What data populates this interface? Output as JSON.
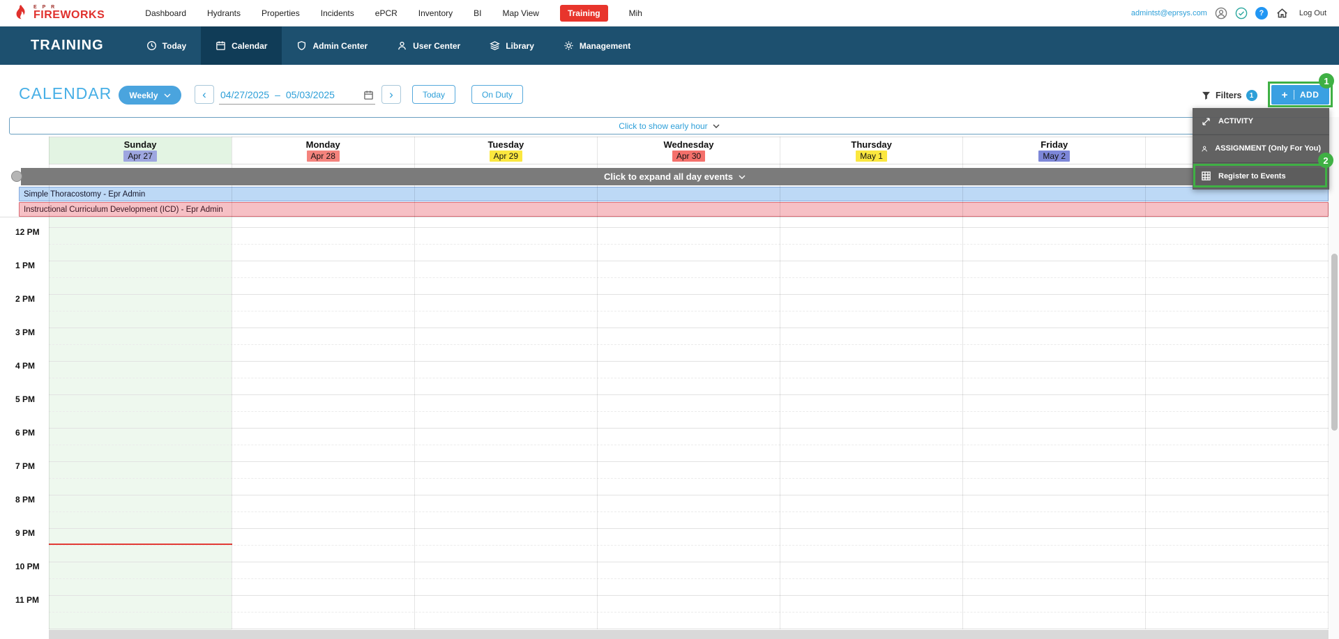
{
  "colors": {
    "brand_red": "#e0312d",
    "navy_bar": "#1d506f",
    "accent_blue": "#2d9fd8",
    "button_blue": "#4aa4de",
    "annotation_green": "#3fb044",
    "sunday_green": "#eef8ee",
    "expand_bar_gray": "#7b7b7b",
    "current_time_red": "#e23b35"
  },
  "icons": {
    "prev": "‹",
    "next": "›",
    "plus": "+",
    "help": "?"
  },
  "topnav": {
    "logo_small": "E P R",
    "logo_main": "FIREWORKS",
    "items": [
      "Dashboard",
      "Hydrants",
      "Properties",
      "Incidents",
      "ePCR",
      "Inventory",
      "BI",
      "Map View",
      "Training",
      "Mih"
    ],
    "active_item": "Training",
    "user_email": "admintst@eprsys.com",
    "logout": "Log Out"
  },
  "subnav": {
    "title": "TRAINING",
    "tabs": [
      {
        "label": "Today",
        "icon": "clock-icon"
      },
      {
        "label": "Calendar",
        "icon": "calendar-icon",
        "active": true
      },
      {
        "label": "Admin Center",
        "icon": "shield-icon"
      },
      {
        "label": "User Center",
        "icon": "user-icon"
      },
      {
        "label": "Library",
        "icon": "layers-icon"
      },
      {
        "label": "Management",
        "icon": "gear-icon"
      }
    ]
  },
  "toolbar": {
    "page_title": "CALENDAR",
    "view_label": "Weekly",
    "date_start": "04/27/2025",
    "date_separator": "–",
    "date_end": "05/03/2025",
    "today": "Today",
    "on_duty": "On Duty",
    "filters_label": "Filters",
    "filters_badge": "1",
    "add_label": "ADD"
  },
  "add_menu": {
    "items": [
      {
        "label": "ACTIVITY",
        "icon": "diagonal-arrows-icon"
      },
      {
        "label": "ASSIGNMENT (Only For You)",
        "icon": "assignee-icon"
      },
      {
        "label": "Register to Events",
        "icon": "grid-icon"
      }
    ]
  },
  "annotations": {
    "step1": "1",
    "step2": "2"
  },
  "calendar": {
    "early_hour_label": "Click to show early hour",
    "expand_label": "Click to expand all day events",
    "days": [
      {
        "name": "Sunday",
        "date": "Apr 27",
        "badge_color": "#9ea6e0",
        "highlight": true
      },
      {
        "name": "Monday",
        "date": "Apr 28",
        "badge_color": "#f4837d"
      },
      {
        "name": "Tuesday",
        "date": "Apr 29",
        "badge_color": "#fbe73f"
      },
      {
        "name": "Wednesday",
        "date": "Apr 30",
        "badge_color": "#f4706b"
      },
      {
        "name": "Thursday",
        "date": "May 1",
        "badge_color": "#fbe73f"
      },
      {
        "name": "Friday",
        "date": "May 2",
        "badge_color": "#7d87d8"
      }
    ],
    "all_day_events": [
      {
        "title": "Simple Thoracostomy - Epr Admin",
        "bg": "#bdd9f6",
        "border": "#84a9dd"
      },
      {
        "title": "Instructional Curriculum Development (ICD) - Epr Admin",
        "bg": "#f6c0c5",
        "border": "#d96a74"
      }
    ],
    "time_labels": [
      "12 PM",
      "1 PM",
      "2 PM",
      "3 PM",
      "4 PM",
      "5 PM",
      "6 PM",
      "7 PM",
      "8 PM",
      "9 PM",
      "10 PM",
      "11 PM"
    ]
  }
}
